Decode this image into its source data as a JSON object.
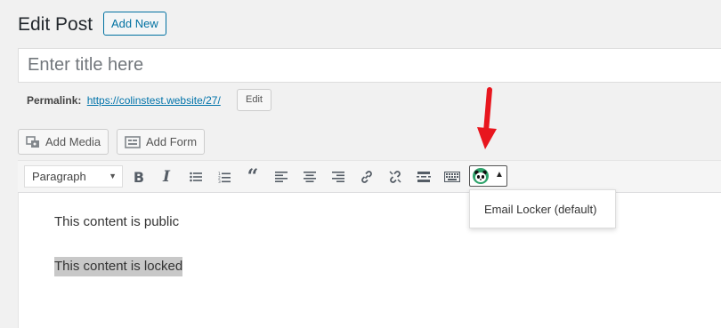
{
  "header": {
    "title": "Edit Post",
    "add_new_label": "Add New"
  },
  "title_field": {
    "placeholder": "Enter title here",
    "value": ""
  },
  "permalink": {
    "label": "Permalink:",
    "url": "https://colinstest.website/27/",
    "edit_label": "Edit"
  },
  "media_buttons": {
    "add_media_label": "Add Media",
    "add_form_label": "Add Form"
  },
  "toolbar": {
    "format_selected": "Paragraph",
    "buttons": [
      "bold-icon",
      "italic-icon",
      "bulleted-list-icon",
      "numbered-list-icon",
      "blockquote-icon",
      "align-left-icon",
      "align-center-icon",
      "align-right-icon",
      "insert-link-icon",
      "remove-link-icon",
      "read-more-icon",
      "toolbar-toggle-icon"
    ]
  },
  "locker_menu": {
    "items": [
      "Email Locker (default)"
    ]
  },
  "content": {
    "public_text": "This content is public",
    "locked_text": "This content is locked"
  },
  "colors": {
    "accent": "#0073aa",
    "arrow": "#e8161e",
    "selection": "#c8c8c8"
  }
}
